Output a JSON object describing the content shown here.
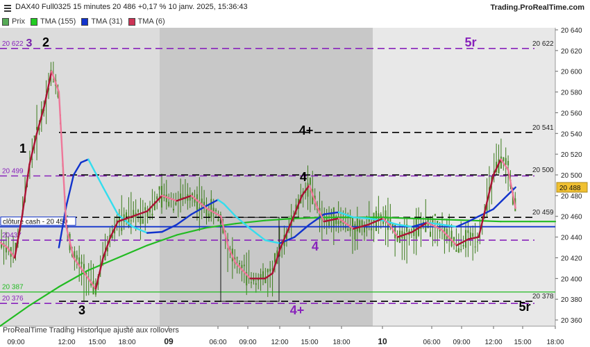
{
  "header": {
    "title": "DAX40 Full0325 15 minutes 20 486 +0,17 % 10 janv. 2025, 15:36:43",
    "site": "Trading.ProRealTime.com"
  },
  "legend": [
    {
      "label": "Prix",
      "color": "#55aa55"
    },
    {
      "label": "TMA (155)",
      "color": "#22cc22"
    },
    {
      "label": "TMA (31)",
      "color": "#1133cc"
    },
    {
      "label": "TMA (6)",
      "color": "#cc3355"
    }
  ],
  "footer": "ProRealTime Trading  Historique ajusté aux rollovers",
  "chart_data": {
    "type": "line",
    "ylim": [
      20354,
      20642
    ],
    "y_ticks": [
      20360,
      20380,
      20400,
      20420,
      20440,
      20460,
      20480,
      20500,
      20520,
      20540,
      20560,
      20580,
      20600,
      20620,
      20640
    ],
    "y_tick_labels": [
      "20 360",
      "20 380",
      "20 400",
      "20 420",
      "20 440",
      "20 460",
      "20 480",
      "20 500",
      "20 520",
      "20 540",
      "20 560",
      "20 580",
      "20 600",
      "20 620",
      "20 640"
    ],
    "x_tick_labels": [
      "09:00",
      "12:00",
      "15:00",
      "18:00",
      "09",
      "06:00",
      "09:00",
      "12:00",
      "15:00",
      "18:00",
      "10",
      "06:00",
      "09:00",
      "12:00",
      "15:00",
      "18:00"
    ],
    "x_tick_bold": [
      false,
      false,
      false,
      false,
      true,
      false,
      false,
      false,
      false,
      false,
      true,
      false,
      false,
      false,
      false,
      false
    ],
    "levels": [
      {
        "value": 20622,
        "style": "purple",
        "left_label": "20 622",
        "right_label": "20 622"
      },
      {
        "value": 20541,
        "style": "black",
        "left_label": "",
        "right_label": "20 541"
      },
      {
        "value": 20500,
        "style": "black",
        "left_label": "",
        "right_label": "20 500"
      },
      {
        "value": 20499,
        "style": "purple",
        "left_label": "20 499",
        "right_label": ""
      },
      {
        "value": 20459,
        "style": "black",
        "left_label": "",
        "right_label": "20 459"
      },
      {
        "value": 20437,
        "style": "purple",
        "left_label": "20437",
        "right_label": ""
      },
      {
        "value": 20378,
        "style": "black",
        "left_label": "",
        "right_label": "20 378"
      },
      {
        "value": 20376,
        "style": "purple",
        "left_label": "20 376",
        "right_label": ""
      }
    ],
    "close_cash": {
      "value": 20450,
      "label": "clôture cash -  20 450",
      "color": "#1133cc"
    },
    "green_level": {
      "value": 20387,
      "label": "20 387",
      "color": "#22bb22"
    },
    "current_price": {
      "value": 20488,
      "label": "20 488",
      "color": "#f0c030"
    },
    "annotations": [
      {
        "text": "3",
        "color": "#7722aa"
      },
      {
        "text": "2",
        "color": "#000000"
      },
      {
        "text": "1",
        "color": "#000000"
      },
      {
        "text": "3",
        "color": "#000000"
      },
      {
        "text": "4+",
        "color": "#000000"
      },
      {
        "text": "4",
        "color": "#000000"
      },
      {
        "text": "4",
        "color": "#8822bb"
      },
      {
        "text": "4+",
        "color": "#8822bb"
      },
      {
        "text": "5r",
        "color": "#8822bb"
      },
      {
        "text": "5r",
        "color": "#000000"
      }
    ],
    "series": [
      {
        "name": "TMA (155)",
        "color": "#22cc22",
        "values": [
          [
            0,
            20354
          ],
          [
            20,
            20374
          ],
          [
            40,
            20392
          ],
          [
            60,
            20408
          ],
          [
            80,
            20420
          ],
          [
            100,
            20432
          ],
          [
            120,
            20442
          ],
          [
            140,
            20449
          ],
          [
            160,
            20453
          ],
          [
            180,
            20456
          ],
          [
            200,
            20458
          ],
          [
            220,
            20459
          ],
          [
            240,
            20459
          ],
          [
            260,
            20459
          ],
          [
            280,
            20458
          ],
          [
            300,
            20457
          ],
          [
            320,
            20456
          ],
          [
            340,
            20455
          ],
          [
            360,
            20455
          ],
          [
            377,
            20455
          ]
        ]
      },
      {
        "name": "TMA (31)",
        "color": "#1133cc",
        "values": [
          [
            40,
            20430
          ],
          [
            45,
            20470
          ],
          [
            50,
            20500
          ],
          [
            55,
            20512
          ],
          [
            60,
            20515
          ],
          [
            70,
            20488
          ],
          [
            80,
            20462
          ],
          [
            90,
            20450
          ],
          [
            100,
            20444
          ],
          [
            110,
            20445
          ],
          [
            120,
            20452
          ],
          [
            130,
            20462
          ],
          [
            140,
            20470
          ],
          [
            148,
            20476
          ],
          [
            152,
            20472
          ],
          [
            160,
            20460
          ],
          [
            170,
            20448
          ],
          [
            180,
            20437
          ],
          [
            190,
            20434
          ],
          [
            200,
            20440
          ],
          [
            210,
            20452
          ],
          [
            220,
            20462
          ],
          [
            230,
            20464
          ],
          [
            240,
            20459
          ],
          [
            250,
            20458
          ],
          [
            260,
            20456
          ],
          [
            270,
            20452
          ],
          [
            280,
            20450
          ],
          [
            290,
            20454
          ],
          [
            300,
            20452
          ],
          [
            310,
            20450
          ],
          [
            318,
            20455
          ],
          [
            325,
            20460
          ],
          [
            335,
            20467
          ],
          [
            345,
            20481
          ],
          [
            350,
            20488
          ]
        ]
      },
      {
        "name": "TMA (6)",
        "color": "#cc3355",
        "values": [
          [
            0,
            20435
          ],
          [
            5,
            20430
          ],
          [
            10,
            20420
          ],
          [
            15,
            20460
          ],
          [
            20,
            20510
          ],
          [
            25,
            20540
          ],
          [
            30,
            20566
          ],
          [
            35,
            20600
          ],
          [
            40,
            20580
          ],
          [
            45,
            20450
          ],
          [
            50,
            20420
          ],
          [
            55,
            20410
          ],
          [
            60,
            20400
          ],
          [
            65,
            20390
          ],
          [
            70,
            20420
          ],
          [
            75,
            20440
          ],
          [
            80,
            20455
          ],
          [
            90,
            20460
          ],
          [
            100,
            20465
          ],
          [
            110,
            20480
          ],
          [
            120,
            20475
          ],
          [
            130,
            20480
          ],
          [
            140,
            20468
          ],
          [
            150,
            20460
          ],
          [
            155,
            20430
          ],
          [
            160,
            20415
          ],
          [
            170,
            20400
          ],
          [
            180,
            20400
          ],
          [
            185,
            20405
          ],
          [
            190,
            20428
          ],
          [
            195,
            20445
          ],
          [
            200,
            20462
          ],
          [
            205,
            20480
          ],
          [
            210,
            20490
          ],
          [
            215,
            20470
          ],
          [
            220,
            20455
          ],
          [
            230,
            20458
          ],
          [
            240,
            20448
          ],
          [
            250,
            20452
          ],
          [
            260,
            20458
          ],
          [
            265,
            20451
          ],
          [
            270,
            20440
          ],
          [
            280,
            20445
          ],
          [
            290,
            20454
          ],
          [
            300,
            20447
          ],
          [
            310,
            20432
          ],
          [
            318,
            20438
          ],
          [
            325,
            20440
          ],
          [
            330,
            20470
          ],
          [
            335,
            20500
          ],
          [
            340,
            20515
          ],
          [
            345,
            20505
          ],
          [
            350,
            20468
          ]
        ]
      }
    ]
  }
}
